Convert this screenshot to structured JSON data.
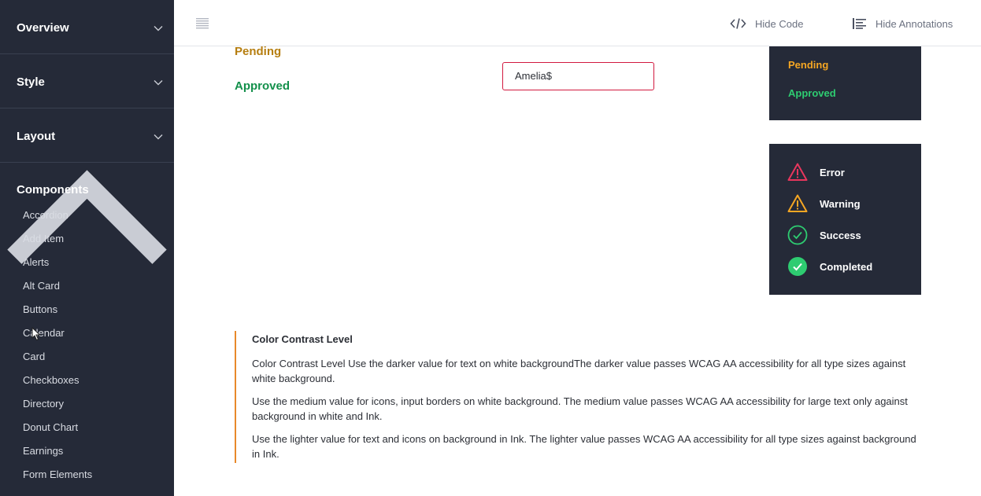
{
  "sidebar": {
    "sections": [
      {
        "label": "Overview"
      },
      {
        "label": "Style"
      },
      {
        "label": "Layout"
      },
      {
        "label": "Components"
      }
    ],
    "items": [
      {
        "label": "Accordion"
      },
      {
        "label": "Add Item"
      },
      {
        "label": "Alerts"
      },
      {
        "label": "Alt Card"
      },
      {
        "label": "Buttons"
      },
      {
        "label": "Calendar"
      },
      {
        "label": "Card"
      },
      {
        "label": "Checkboxes"
      },
      {
        "label": "Directory"
      },
      {
        "label": "Donut Chart"
      },
      {
        "label": "Earnings"
      },
      {
        "label": "Form Elements"
      }
    ]
  },
  "topbar": {
    "hide_code": "Hide Code",
    "hide_annotations": "Hide Annotations"
  },
  "content": {
    "status_pending": "Pending",
    "status_approved": "Approved",
    "input_value": "Amelia$",
    "dark_pending": "Pending",
    "dark_approved": "Approved",
    "icons": [
      {
        "label": "Error",
        "icon": "error-triangle-icon",
        "color": "#e8365d"
      },
      {
        "label": "Warning",
        "icon": "warning-triangle-icon",
        "color": "#f5a623"
      },
      {
        "label": "Success",
        "icon": "success-check-circle-icon",
        "color": "#2ecc71"
      },
      {
        "label": "Completed",
        "icon": "completed-check-circle-icon",
        "color": "#2ecc71"
      }
    ]
  },
  "annotation": {
    "title": "Color Contrast Level",
    "paragraphs": [
      "Color Contrast Level Use the darker value for text on white backgroundThe darker value passes WCAG AA accessibility for all type sizes against white background.",
      "Use the medium value for icons, input borders on white background. The medium value passes WCAG AA accessibility for large text only against background in white and Ink.",
      "Use the lighter value for text and icons on background in Ink. The lighter value passes WCAG AA accessibility for all type sizes against background in Ink."
    ]
  },
  "colors": {
    "sidebar_bg": "#252a38",
    "pending": "#b67e10",
    "approved": "#13904b",
    "input_border_error": "#d2193f",
    "annotation_accent": "#e8892a"
  }
}
